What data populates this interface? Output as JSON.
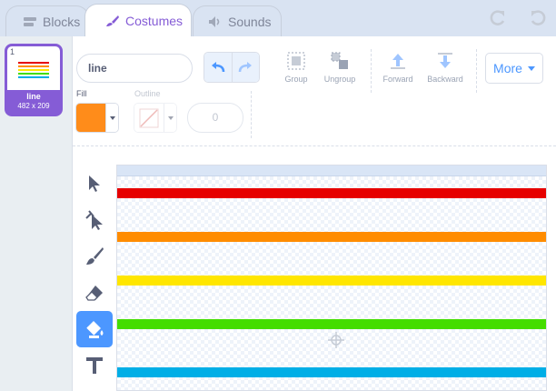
{
  "tabs": {
    "blocks": "Blocks",
    "costumes": "Costumes",
    "sounds": "Sounds"
  },
  "costume": {
    "index": "1",
    "name": "line",
    "size": "482 x 209"
  },
  "toolbar": {
    "costume_name_value": "line",
    "group": "Group",
    "ungroup": "Ungroup",
    "forward": "Forward",
    "backward": "Backward",
    "more": "More"
  },
  "style": {
    "fill_label": "Fill",
    "outline_label": "Outline",
    "outline_width": "0",
    "fill_color": "#ff8c1a"
  },
  "canvas": {
    "stripe_colors": [
      "#e60000",
      "#ff8c00",
      "#ffe600",
      "#44dd00",
      "#00aee6"
    ]
  },
  "icons": {
    "blocks_tab": "blocks-icon",
    "costumes_tab": "brush-icon",
    "sounds_tab": "speaker-icon",
    "tools": [
      "select-arrow-icon",
      "reshape-icon",
      "brush-icon",
      "eraser-icon",
      "fill-bucket-icon",
      "text-icon"
    ]
  },
  "colors": {
    "accent_purple": "#855cd6",
    "accent_blue": "#4c97ff"
  }
}
